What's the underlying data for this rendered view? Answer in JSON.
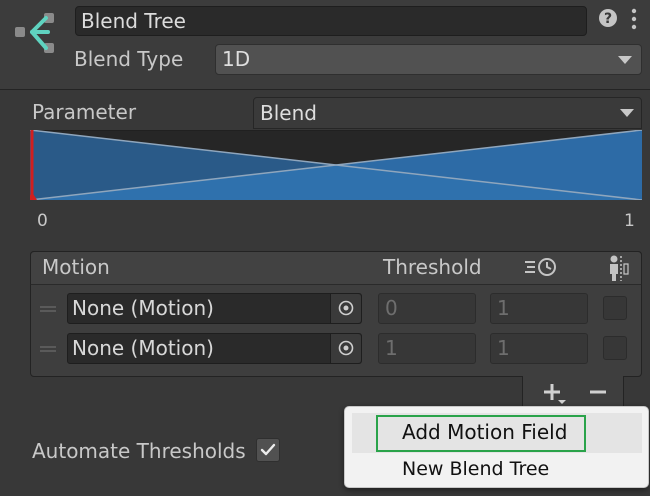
{
  "header": {
    "name_value": "Blend Tree",
    "help_icon": "help-icon",
    "menu_icon": "kebab-menu-icon"
  },
  "blend_type": {
    "label": "Blend Type",
    "selected": "1D"
  },
  "parameter": {
    "label": "Parameter",
    "selected": "Blend"
  },
  "graph": {
    "min_label": "0",
    "max_label": "1",
    "fill_color": "#2e6da4",
    "marker_color": "#d11f1f"
  },
  "motion_list": {
    "headers": {
      "motion": "Motion",
      "threshold": "Threshold",
      "time_scale_icon": "time-scale-icon",
      "mirror_icon": "mirror-icon"
    },
    "rows": [
      {
        "motion": "None (Motion)",
        "threshold": "0",
        "time_scale": "1",
        "mirror": false
      },
      {
        "motion": "None (Motion)",
        "threshold": "1",
        "time_scale": "1",
        "mirror": false
      }
    ],
    "add_icon": "plus-dropdown-icon",
    "remove_icon": "minus-icon"
  },
  "automate_thresholds": {
    "label": "Automate Thresholds",
    "checked": true
  },
  "context_menu": {
    "items": [
      "Add Motion Field",
      "New Blend Tree"
    ],
    "focus_color": "#2aa34a"
  }
}
